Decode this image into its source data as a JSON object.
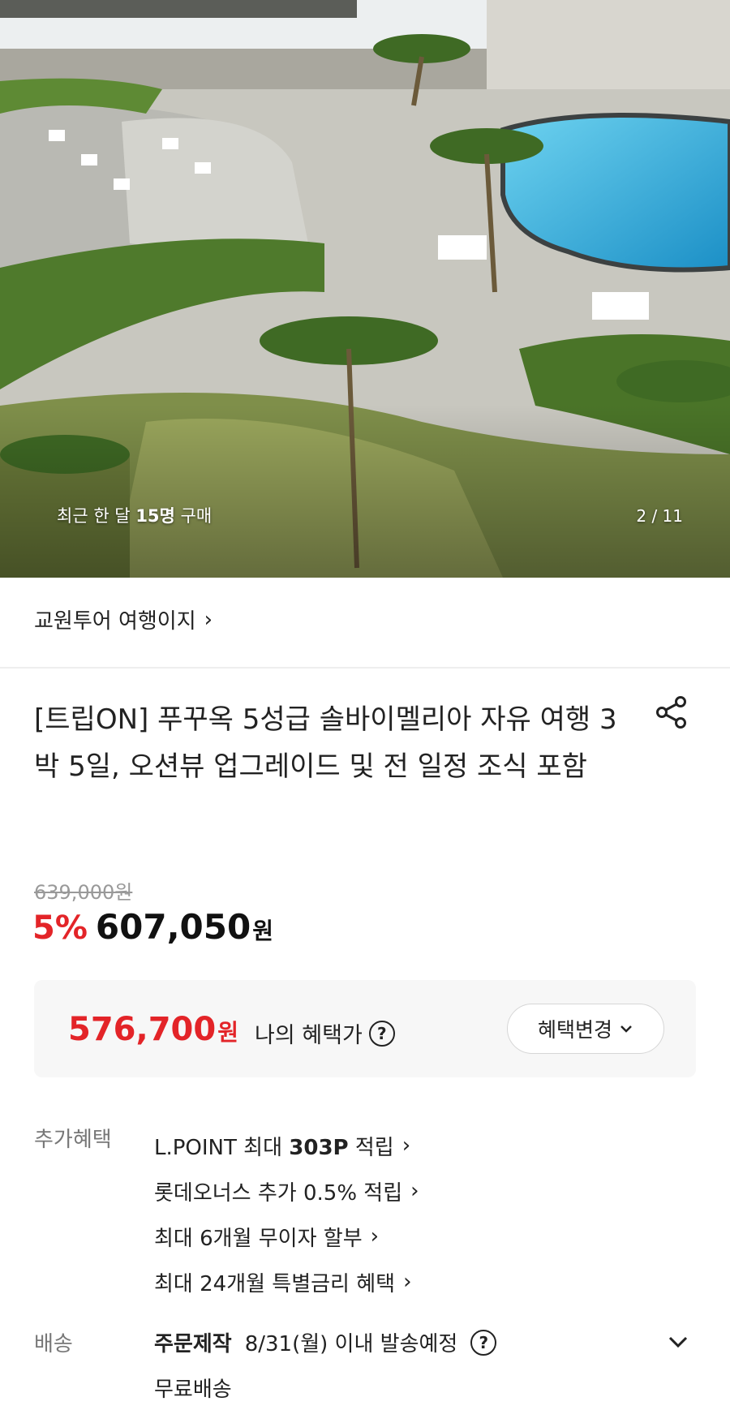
{
  "hero": {
    "purchase_prefix": "최근 한 달 ",
    "purchase_count": "15명",
    "purchase_suffix": " 구매",
    "counter": "2 / 11"
  },
  "seller": {
    "name": "교원투어 여행이지",
    "chevron": "›"
  },
  "product": {
    "title": "[트립ON] 푸꾸옥 5성급 솔바이멜리아 자유 여행 3박 5일, 오션뷰 업그레이드 및 전 일정 조식 포함"
  },
  "price": {
    "original": "639,000원",
    "discount": "5%",
    "sale": "607,050",
    "currency": "원"
  },
  "benefit": {
    "price": "576,700",
    "currency": "원",
    "label": "나의 혜택가",
    "help_icon": "?",
    "change_button": "혜택변경"
  },
  "extra_benefits": {
    "label": "추가혜택",
    "items": [
      {
        "text": "L.POINT 최대 ",
        "bold": "303P",
        "suffix": " 적립"
      },
      {
        "text": "롯데오너스 추가 0.5% 적립"
      },
      {
        "text": "최대 6개월 무이자 할부"
      },
      {
        "text": "최대 24개월 특별금리 혜택"
      }
    ]
  },
  "shipping": {
    "label": "배송",
    "type": "주문제작",
    "schedule": "8/31(월) 이내 발송예정",
    "help_icon": "?",
    "fee": "무료배송"
  },
  "colors": {
    "accent_red": "#e32428",
    "muted": "#999999",
    "box_bg": "#f7f7f7"
  }
}
